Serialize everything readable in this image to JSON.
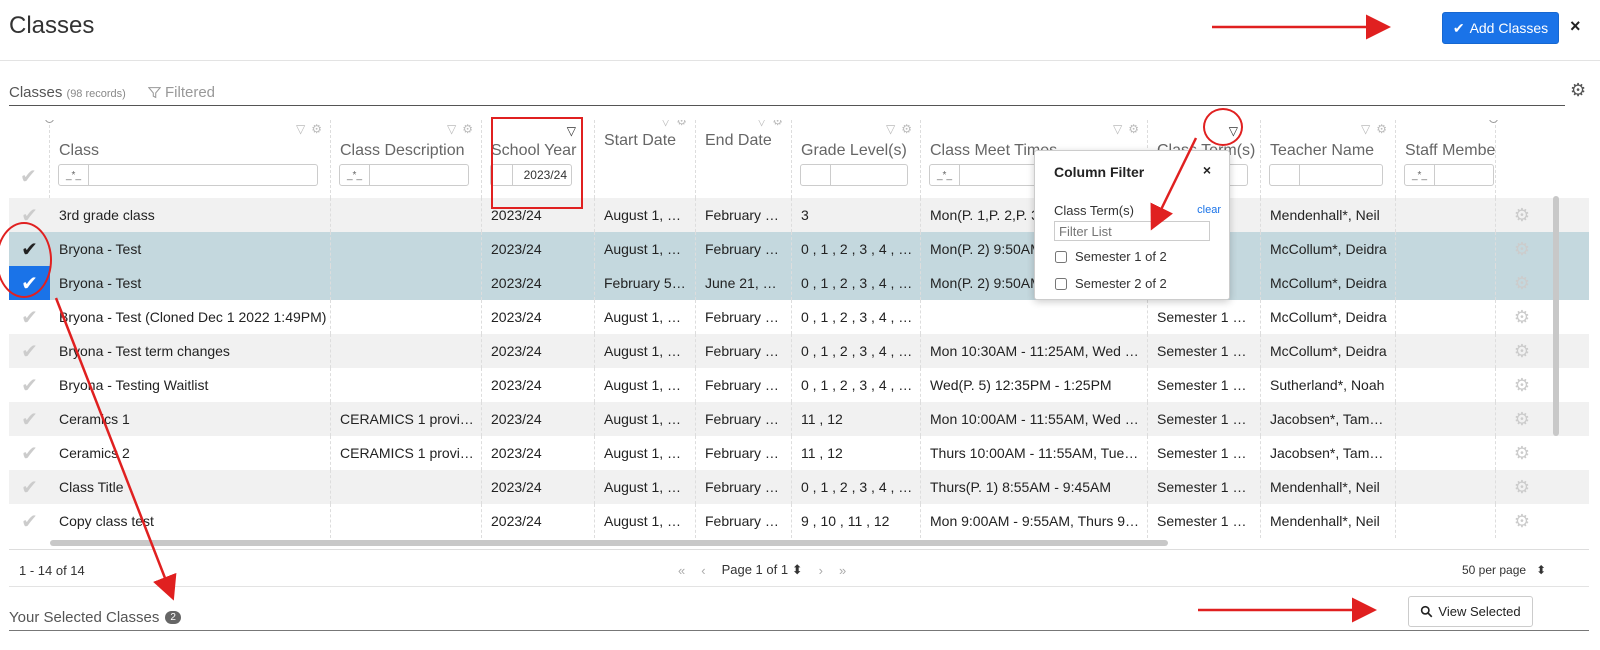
{
  "header": {
    "title": "Classes",
    "add_button_label": "Add Classes",
    "close_label": "×"
  },
  "grid": {
    "title": "Classes",
    "record_count": "(98 records)",
    "filtered_label": "Filtered",
    "columns": [
      {
        "label": "Class",
        "filter_op": "_*_",
        "filter_value": ""
      },
      {
        "label": "Class Description",
        "filter_op": "_*_",
        "filter_value": ""
      },
      {
        "label": "School Year",
        "filter_op": "",
        "filter_value": "2023/24"
      },
      {
        "label": "Start Date"
      },
      {
        "label": "End Date"
      },
      {
        "label": "Grade Level(s)",
        "filter_op": "",
        "filter_value": ""
      },
      {
        "label": "Class Meet Times",
        "filter_op": "_*_",
        "filter_value": ""
      },
      {
        "label": "Class Term(s)",
        "filter_op": "",
        "filter_value": ""
      },
      {
        "label": "Teacher Name",
        "filter_op": "",
        "filter_value": ""
      },
      {
        "label": "Staff Membe",
        "filter_op": "_*_",
        "filter_value": ""
      }
    ],
    "rows": [
      {
        "checked": false,
        "cells": [
          "3rd grade class",
          "",
          "2023/24",
          "August 1, …",
          "February …",
          "3",
          "Mon(P. 1,P. 2,P. 3",
          "",
          "Mendenhall*, Neil"
        ]
      },
      {
        "checked": true,
        "cells": [
          "Bryona - Test",
          "",
          "2023/24",
          "August 1, …",
          "February …",
          "0 , 1 , 2 , 3 , 4 , …",
          "Mon(P. 2) 9:50AM",
          "",
          "McCollum*, Deidra"
        ]
      },
      {
        "checked": true,
        "cells": [
          "Bryona - Test",
          "",
          "2023/24",
          "February 5…",
          "June 21, …",
          "0 , 1 , 2 , 3 , 4 , …",
          "Mon(P. 2) 9:50AM",
          "",
          "McCollum*, Deidra"
        ]
      },
      {
        "checked": false,
        "cells": [
          "Bryona - Test (Cloned Dec 1 2022 1:49PM)",
          "",
          "2023/24",
          "August 1, …",
          "February …",
          "0 , 1 , 2 , 3 , 4 , …",
          "",
          "Semester 1 …",
          "McCollum*, Deidra"
        ]
      },
      {
        "checked": false,
        "cells": [
          "Bryona - Test term changes",
          "",
          "2023/24",
          "August 1, …",
          "February …",
          "0 , 1 , 2 , 3 , 4 , …",
          "Mon 10:30AM - 11:25AM, Wed …",
          "Semester 1 …",
          "McCollum*, Deidra"
        ]
      },
      {
        "checked": false,
        "cells": [
          "Bryona - Testing Waitlist",
          "",
          "2023/24",
          "August 1, …",
          "February …",
          "0 , 1 , 2 , 3 , 4 , …",
          "Wed(P. 5) 12:35PM - 1:25PM",
          "Semester 1 …",
          "Sutherland*, Noah"
        ]
      },
      {
        "checked": false,
        "cells": [
          "Ceramics 1",
          "CERAMICS 1 provi…",
          "2023/24",
          "August 1, …",
          "February …",
          "11 , 12",
          "Mon 10:00AM - 11:55AM, Wed …",
          "Semester 1 …",
          "Jacobsen*, Tam…"
        ]
      },
      {
        "checked": false,
        "cells": [
          "Ceramics 2",
          "CERAMICS 1 provi…",
          "2023/24",
          "August 1, …",
          "February …",
          "11 , 12",
          "Thurs 10:00AM - 11:55AM, Tue…",
          "Semester 1 …",
          "Jacobsen*, Tam…"
        ]
      },
      {
        "checked": false,
        "cells": [
          "Class Title",
          "",
          "2023/24",
          "August 1, …",
          "February …",
          "0 , 1 , 2 , 3 , 4 , …",
          "Thurs(P. 1) 8:55AM - 9:45AM",
          "Semester 1 …",
          "Mendenhall*, Neil"
        ]
      },
      {
        "checked": false,
        "cells": [
          "Copy class test",
          "",
          "2023/24",
          "August 1, …",
          "February …",
          "9 , 10 , 11 , 12",
          "Mon 9:00AM - 9:55AM, Thurs 9…",
          "Semester 1 …",
          "Mendenhall*, Neil"
        ]
      }
    ]
  },
  "column_filter": {
    "title": "Column Filter",
    "close_label": "×",
    "field_label": "Class Term(s)",
    "clear_label": "clear",
    "search_placeholder": "Filter List",
    "options": [
      "Semester 1 of 2",
      "Semester 2 of 2"
    ]
  },
  "pager": {
    "range": "1 - 14 of 14",
    "first": "«",
    "prev": "‹",
    "page_label": "Page 1 of 1",
    "next": "›",
    "last": "»",
    "per_page": "50 per page"
  },
  "selected": {
    "title": "Your Selected Classes",
    "count": "2",
    "view_button_label": "View Selected"
  },
  "colors": {
    "accent": "#1a73e8",
    "selected_row": "#c4d8de",
    "annotation": "#e02020"
  }
}
